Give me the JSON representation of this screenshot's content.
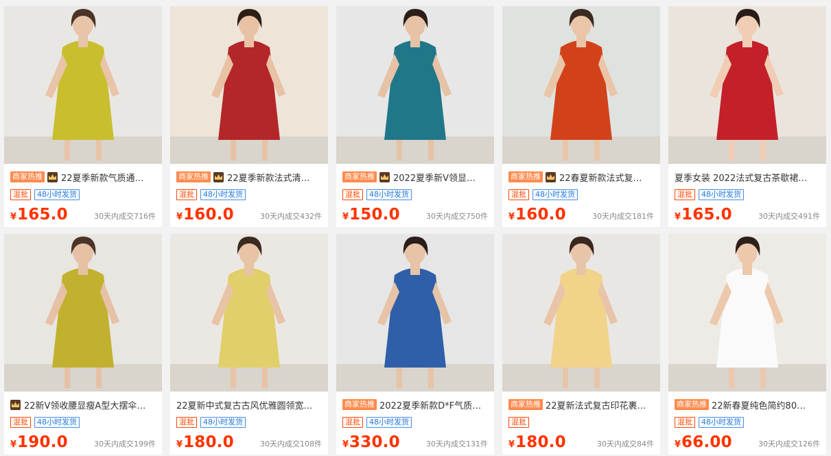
{
  "products": [
    {
      "title": "22夏季新款气质通…",
      "hot_tag": "商家热推",
      "crown": true,
      "badges": [
        "混批",
        "48小时发货"
      ],
      "currency": "¥",
      "price": "165.0",
      "sales": "30天内成交716件",
      "image": {
        "bg": "#e9e7e3",
        "dress": "#c9be2d",
        "skin": "#e8c4a8",
        "hair": "#4a3426"
      }
    },
    {
      "title": "22夏季新款法式清…",
      "hot_tag": "商家热推",
      "crown": true,
      "badges": [
        "混批",
        "48小时发货"
      ],
      "currency": "¥",
      "price": "160.0",
      "sales": "30天内成交432件",
      "image": {
        "bg": "#ece5d8",
        "dress": "#b3262a",
        "skin": "#e9c1a4",
        "hair": "#2d1f18"
      }
    },
    {
      "title": "2022夏季新V领显…",
      "hot_tag": "商家热推",
      "crown": true,
      "badges": [
        "混批",
        "48小时发货"
      ],
      "currency": "¥",
      "price": "150.0",
      "sales": "30天内成交750件",
      "image": {
        "bg": "#e7e7e7",
        "dress": "#21778a",
        "skin": "#e6c2a6",
        "hair": "#2b1e17"
      }
    },
    {
      "title": "22春夏新款法式复…",
      "hot_tag": "商家热推",
      "crown": true,
      "badges": [
        "混批",
        "48小时发货"
      ],
      "currency": "¥",
      "price": "160.0",
      "sales": "30天内成交181件",
      "image": {
        "bg": "#dfe3e0",
        "dress": "#d2421a",
        "skin": "#ebc5a8",
        "hair": "#3a2a20"
      }
    },
    {
      "title": "夏季女装 2022法式复古茶歇裙…",
      "hot_tag": "",
      "crown": false,
      "badges": [
        "混批",
        "48小时发货"
      ],
      "currency": "¥",
      "price": "165.0",
      "sales": "30天内成交491件",
      "image": {
        "bg": "#eae4dc",
        "dress": "#c4202a",
        "skin": "#f0cdb4",
        "hair": "#2a1c16"
      }
    },
    {
      "title": "22新V领收腰显瘦A型大摆伞…",
      "hot_tag": "",
      "crown": true,
      "badges": [
        "混批",
        "48小时发货"
      ],
      "currency": "¥",
      "price": "190.0",
      "sales": "30天内成交199件",
      "image": {
        "bg": "#e8e6e1",
        "dress": "#c2b12f",
        "skin": "#e6c1a5",
        "hair": "#4a3528"
      }
    },
    {
      "title": "22夏新中式复古古风优雅圆领宽…",
      "hot_tag": "",
      "crown": false,
      "badges": [
        "混批",
        "48小时发货"
      ],
      "currency": "¥",
      "price": "180.0",
      "sales": "30天内成交108件",
      "image": {
        "bg": "#ebe8e3",
        "dress": "#e0cf6a",
        "skin": "#e8c3a6",
        "hair": "#3b2a22"
      }
    },
    {
      "title": "2022夏季新款D*F气质…",
      "hot_tag": "商家热推",
      "crown": false,
      "badges": [
        "混批",
        "48小时发货"
      ],
      "currency": "¥",
      "price": "330.0",
      "sales": "30天内成交131件",
      "image": {
        "bg": "#e6e6e6",
        "dress": "#2e5fa8",
        "skin": "#e7c3a7",
        "hair": "#2a1e18"
      }
    },
    {
      "title": "22夏新法式复古印花裹…",
      "hot_tag": "商家热推",
      "crown": false,
      "badges": [
        "混批"
      ],
      "currency": "¥",
      "price": "180.0",
      "sales": "30天内成交84件",
      "image": {
        "bg": "#e9e7e3",
        "dress": "#f1d38a",
        "skin": "#e8c4a8",
        "hair": "#3a2820"
      }
    },
    {
      "title": "22新春夏纯色简约80…",
      "hot_tag": "商家热推",
      "crown": false,
      "badges": [
        "混批",
        "48小时发货"
      ],
      "currency": "¥",
      "price": "66.00",
      "sales": "30天内成交126件",
      "image": {
        "bg": "#eeebe6",
        "dress": "#fafafa",
        "skin": "#ecc8ac",
        "hair": "#2e2018"
      }
    }
  ]
}
